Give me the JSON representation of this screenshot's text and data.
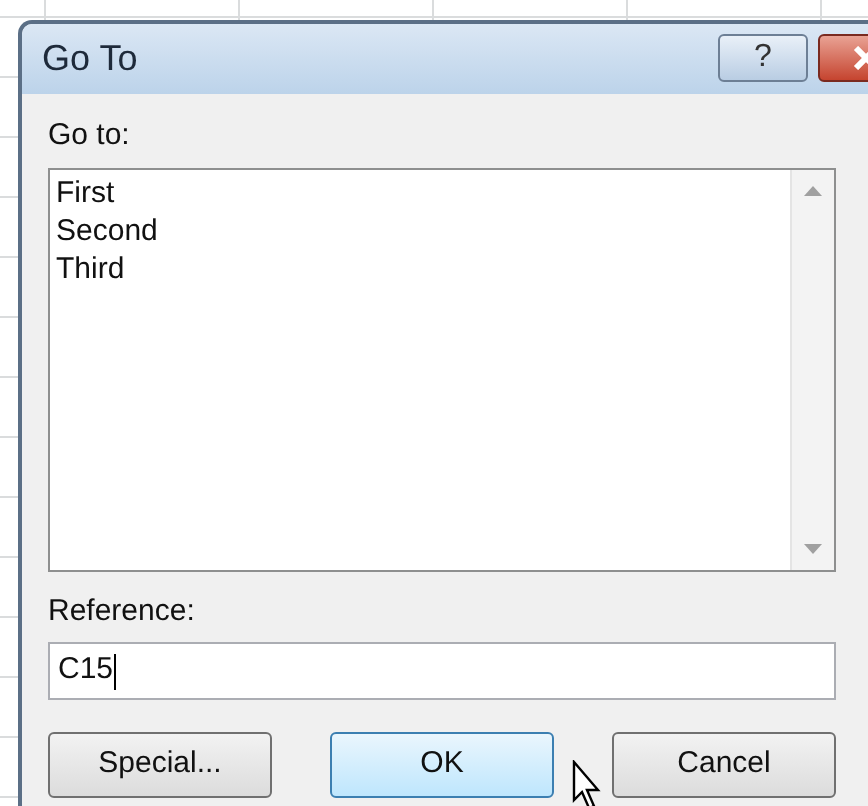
{
  "window": {
    "title": "Go To",
    "title_buttons": [
      {
        "kind": "help",
        "label": "?"
      },
      {
        "kind": "close"
      }
    ]
  },
  "goto": {
    "label": "Go to:",
    "items": [
      "First",
      "Second",
      "Third"
    ]
  },
  "reference": {
    "label": "Reference:",
    "value": "C15"
  },
  "buttons": [
    {
      "label": "Special...",
      "default": false
    },
    {
      "label": "OK",
      "default": true
    },
    {
      "label": "Cancel",
      "default": false
    }
  ]
}
